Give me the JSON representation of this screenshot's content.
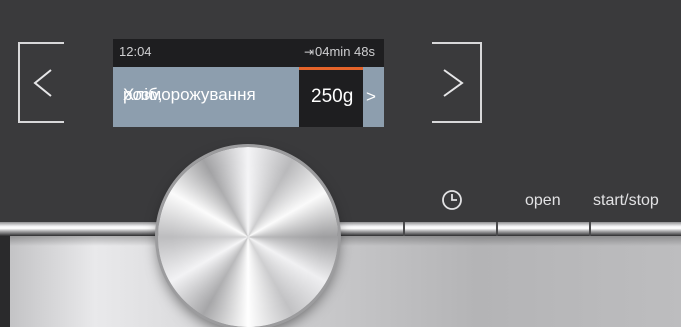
{
  "display": {
    "clock": "12:04",
    "timer_icon": "⇥",
    "remaining_time": "04min 48s",
    "program_name_line1": "Хліб,",
    "program_name_line2": "розморожування",
    "weight": "250g",
    "next_arrow": ">"
  },
  "navigation": {
    "prev_icon": "chevron-left-icon",
    "next_icon": "chevron-right-icon"
  },
  "buttons": {
    "timer_icon": "clock-icon",
    "open_label": "open",
    "start_stop_label": "start/stop"
  },
  "colors": {
    "panel": "#3a3a3c",
    "program_highlight": "#8d9eae",
    "weight_indicator": "#e5642a"
  }
}
